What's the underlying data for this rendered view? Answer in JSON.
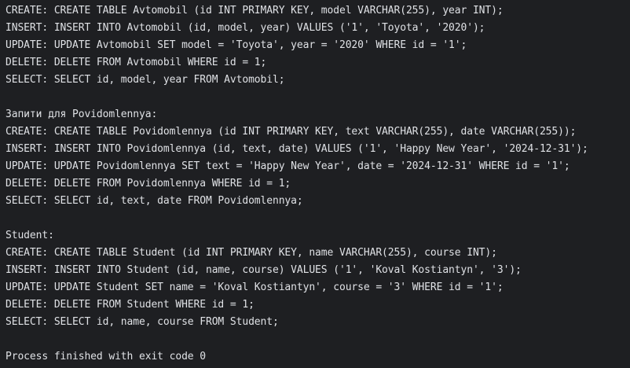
{
  "console": {
    "lines": [
      "CREATE: CREATE TABLE Avtomobil (id INT PRIMARY KEY, model VARCHAR(255), year INT);",
      "INSERT: INSERT INTO Avtomobil (id, model, year) VALUES ('1', 'Toyota', '2020');",
      "UPDATE: UPDATE Avtomobil SET model = 'Toyota', year = '2020' WHERE id = '1';",
      "DELETE: DELETE FROM Avtomobil WHERE id = 1;",
      "SELECT: SELECT id, model, year FROM Avtomobil;",
      "",
      "Запити для Povidomlennya:",
      "CREATE: CREATE TABLE Povidomlennya (id INT PRIMARY KEY, text VARCHAR(255), date VARCHAR(255));",
      "INSERT: INSERT INTO Povidomlennya (id, text, date) VALUES ('1', 'Happy New Year', '2024-12-31');",
      "UPDATE: UPDATE Povidomlennya SET text = 'Happy New Year', date = '2024-12-31' WHERE id = '1';",
      "DELETE: DELETE FROM Povidomlennya WHERE id = 1;",
      "SELECT: SELECT id, text, date FROM Povidomlennya;",
      "",
      "Student:",
      "CREATE: CREATE TABLE Student (id INT PRIMARY KEY, name VARCHAR(255), course INT);",
      "INSERT: INSERT INTO Student (id, name, course) VALUES ('1', 'Koval Kostiantyn', '3');",
      "UPDATE: UPDATE Student SET name = 'Koval Kostiantyn', course = '3' WHERE id = '1';",
      "DELETE: DELETE FROM Student WHERE id = 1;",
      "SELECT: SELECT id, name, course FROM Student;",
      "",
      "Process finished with exit code 0"
    ]
  }
}
